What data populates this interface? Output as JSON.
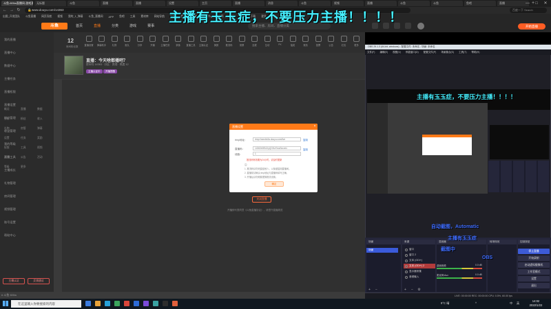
{
  "browser": {
    "tabs": [
      "斗鱼-600w直播间-游戏直播",
      "无标题",
      "斗鱼",
      "直播",
      "直播",
      "设置",
      "主页",
      "直播",
      "消息",
      "斗鱼",
      "视频",
      "直播",
      "斗鱼",
      "斗鱼",
      "鱼吧",
      "直播"
    ],
    "url": "www.douyu.com/14363",
    "search_placeholder": "百度一下 Search",
    "bookmarks": [
      "出图_开发团队",
      "斗鱼直播",
      "网页导航",
      "视频",
      "我的_1_弹幕",
      "斗鱼_直播间",
      "APP",
      "鱼吧",
      "工具",
      "素材库",
      "网站导航",
      "设置",
      "鱼乐",
      "直播",
      "主播中心",
      "弹幕",
      "收藏",
      "推荐",
      "下载",
      "更多"
    ]
  },
  "site": {
    "logo": "斗鱼",
    "nav": [
      "首页",
      "直播",
      "分类",
      "游戏",
      "赛事"
    ],
    "nav_active": 1,
    "search_placeholder": "搜索主播、房间、直播分类",
    "start_live": "开始直播"
  },
  "overlay": {
    "danmaku_main": "主播有玉玉症，不要压力主播！！！！",
    "danmaku_preview": "主播有玉玉症，不要压力主播！！！！"
  },
  "sidebar": {
    "items": [
      "我的直播",
      "直播中心",
      "数据中心",
      "主播任务",
      "直播权限",
      "直播设置",
      "粉丝管理",
      "收益管理",
      "我的等级",
      "直播工具",
      "主播成长",
      "礼物管理",
      "房间管理",
      "视频管理",
      "账号设置",
      "帮助中心"
    ],
    "sub": [
      "概况",
      "直播",
      "数据",
      "分析",
      "粉丝",
      "收入",
      "礼物",
      "房管",
      "弹幕",
      "设置",
      "任务",
      "奖励",
      "权限",
      "工具",
      "视频",
      "消息",
      "公告",
      "活动",
      "等级",
      "更多"
    ],
    "buttons": [
      "主播认证",
      "反馈建议"
    ]
  },
  "toolbar": {
    "count": "12",
    "count_label": "房间粉丝数",
    "tools": [
      "直播设置",
      "弹幕助手",
      "礼物",
      "鱼丸",
      "分享",
      "开播",
      "主播任务",
      "录像",
      "直播工具",
      "主播认证",
      "美颜",
      "推流码",
      "录屏",
      "连麦",
      "互动",
      "PK",
      "抽奖",
      "竞猜",
      "投票",
      "公告",
      "红包",
      "更多"
    ]
  },
  "room": {
    "title": "直播：今天啥都播吧？",
    "meta": "房间号 14363 · 分区：其他 · 热度 12",
    "tags": [
      "主播认证中",
      "开播提醒"
    ]
  },
  "modal": {
    "title": "直播设置",
    "rtmp_label": "rtmp地址：",
    "rtmp_value": "rtmp://sendtc3a.douyu.com/live",
    "key_label": "直播码：",
    "key_value": "14363rKfEAXyQOHzf?wsSecret=",
    "line_label": "线路：",
    "line_value": "1",
    "copy": "复制",
    "warn": "推流码有效期为24小时，请及时更新",
    "notes": [
      "注：",
      "1. 推流码请勿泄露给他人，以免被盗用直播间。",
      "2. 直播前请确认rtmp地址与直播码填写正确，",
      "3. 开播后请勿频繁更换推流设置。"
    ],
    "confirm": "确定"
  },
  "page": {
    "stop_button": "关闭直播",
    "agreement": "开播即代表同意《斗鱼直播协议》，请遵守直播规范"
  },
  "obs": {
    "title": "OBS 29.1.3 (64-bit, windows) - 配置文件: 未命名 - 场景: 未命名",
    "menu": [
      "文件(F)",
      "编辑(E)",
      "视图(V)",
      "停靠窗口(D)",
      "配置文件(P)",
      "场景集合(S)",
      "工具(T)",
      "帮助(H)"
    ],
    "docks": [
      "场景",
      "来源",
      "混音器",
      "转场特效",
      "控制按钮"
    ],
    "scene": "场景",
    "sources": [
      "窗口",
      "窗口 2",
      "文本 (GDI+)",
      "文本 (GDI+) 2",
      "显示器采集",
      "音频输入"
    ],
    "mixer": [
      "桌面音频",
      "麦克风/Aux"
    ],
    "mixer_db": [
      "0.0 dB",
      "0.0 dB"
    ],
    "controls": [
      "停止直播",
      "开始录制",
      "启动虚拟摄像机",
      "工作室模式",
      "设置",
      "退出"
    ],
    "status": "LIVE: 00:00:00   REC: 00:00:00   CPU: 0.5%, 60.00 fps",
    "danmaku": [
      "自动截图，Automatic",
      "主播有玉玉症",
      "截图中",
      "OBS"
    ]
  },
  "recbar": {
    "text": "# 斗鱼 600w"
  },
  "taskbar": {
    "search": "在这里输入你要搜索的内容",
    "tray": [
      "^",
      "中",
      "英"
    ],
    "weather": "9°C 晴",
    "time": "14:02",
    "date": "2022/1/22"
  }
}
